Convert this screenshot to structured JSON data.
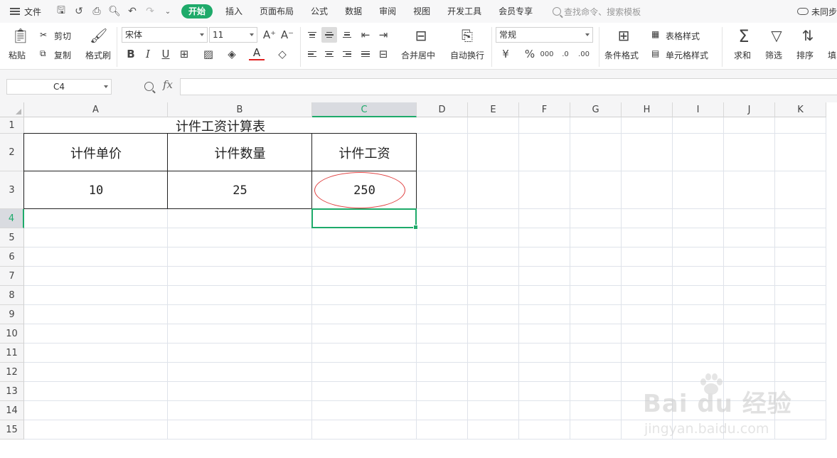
{
  "menubar": {
    "file_label": "文件",
    "tabs": [
      "开始",
      "插入",
      "页面布局",
      "公式",
      "数据",
      "审阅",
      "视图",
      "开发工具",
      "会员专享"
    ],
    "search_placeholder": "查找命令、搜索模板",
    "cloud_label": "未同步"
  },
  "ribbon": {
    "paste": "粘贴",
    "cut": "剪切",
    "copy": "复制",
    "format_painter": "格式刷",
    "font_name": "宋体",
    "font_size": "11",
    "merge_center": "合并居中",
    "wrap_text": "自动换行",
    "number_format": "常规",
    "conditional_format": "条件格式",
    "table_style": "表格样式",
    "cell_style": "单元格样式",
    "sum": "求和",
    "filter": "筛选",
    "sort": "排序",
    "fill": "填"
  },
  "formula_bar": {
    "name_box": "C4",
    "fx": "fx",
    "formula": ""
  },
  "sheet": {
    "columns": [
      "A",
      "B",
      "C",
      "D",
      "E",
      "F",
      "G",
      "H",
      "I",
      "J",
      "K"
    ],
    "rows": [
      "1",
      "2",
      "3",
      "4",
      "5",
      "6",
      "7",
      "8",
      "9",
      "10",
      "11",
      "12",
      "13",
      "14",
      "15"
    ],
    "selected_cell": "C4",
    "title": "计件工资计算表",
    "headers": [
      "计件单价",
      "计件数量",
      "计件工资"
    ],
    "values": [
      "10",
      "25",
      "250"
    ]
  },
  "watermark": {
    "brand": "Bai du 经验",
    "url": "jingyan.baidu.com"
  },
  "colors": {
    "accent": "#1eaa6a",
    "annotation": "#e04040"
  }
}
